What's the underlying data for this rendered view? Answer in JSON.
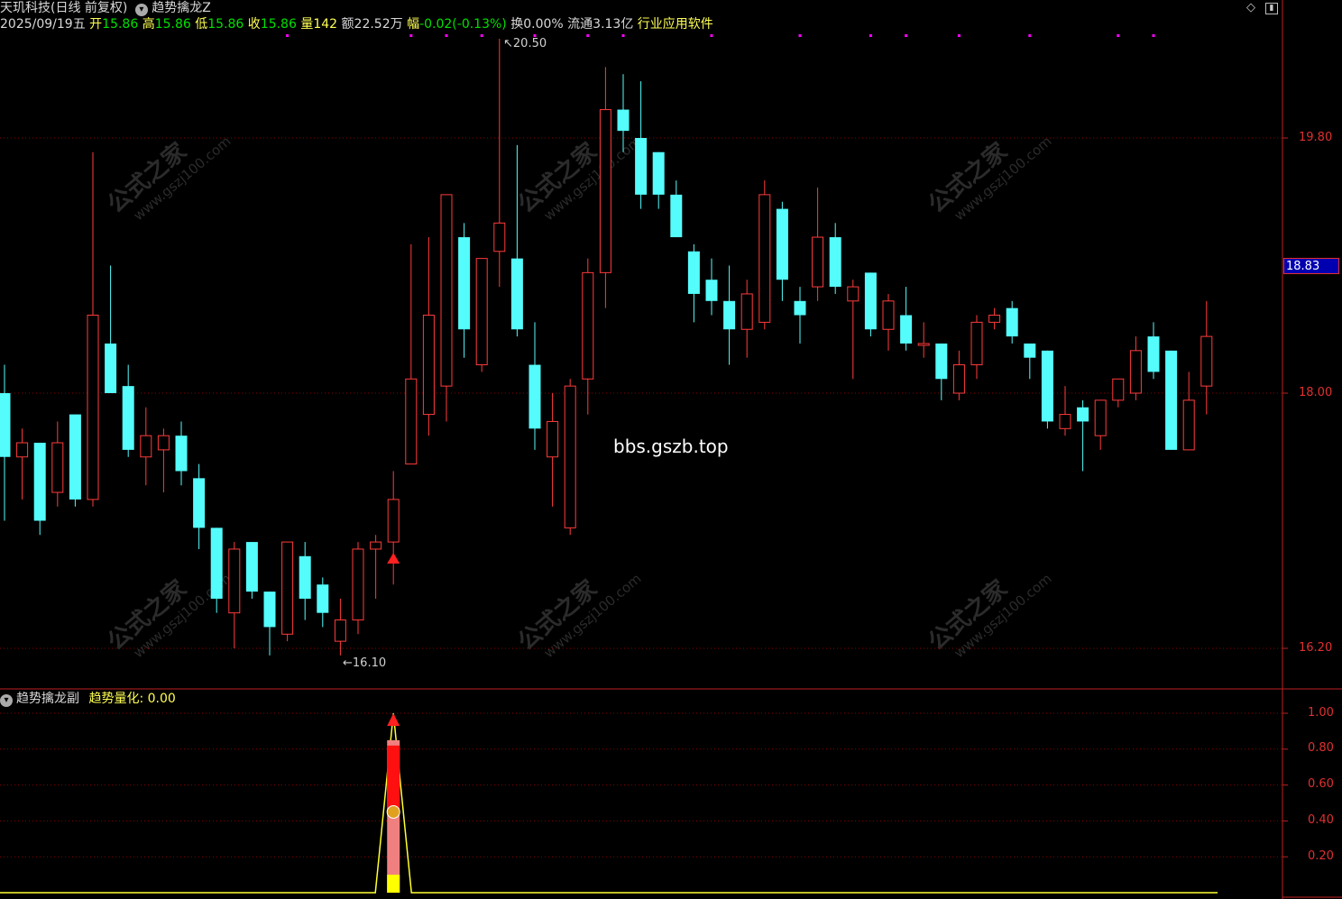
{
  "header": {
    "stock_name": "天玑科技",
    "period": "(日线 前复权)",
    "indicator": "趋势擒龙Z",
    "date": "2025/09/19",
    "weekday": "五",
    "open_label": "开",
    "open": "15.86",
    "high_label": "高",
    "high": "15.86",
    "low_label": "低",
    "low": "15.86",
    "close_label": "收",
    "close": "15.86",
    "vol_label": "量",
    "vol": "142",
    "amount_label": "额",
    "amount": "22.52万",
    "change_label": "幅",
    "change": "-0.02(-0.13%)",
    "turnover_label": "换",
    "turnover": "0.00%",
    "float_label": "流通",
    "float": "3.13亿",
    "industry": "行业应用软件"
  },
  "main_chart": {
    "y_labels": [
      "19.80",
      "18.83",
      "18.00",
      "16.20"
    ],
    "current_price": "18.83",
    "high_marker": "20.50",
    "low_marker": "16.10",
    "site_text": "bbs.gszb.top",
    "colors": {
      "up": "#ff3b3b",
      "down": "#54fcfc",
      "grid": "#8b0000",
      "marker": "#ff00ff"
    }
  },
  "sub_chart": {
    "title": "趋势擒龙副",
    "series_label": "趋势量化:",
    "series_value": "0.00",
    "y_labels": [
      "1.00",
      "0.80",
      "0.60",
      "0.40",
      "0.20"
    ]
  },
  "watermark": {
    "cn": "公式之家",
    "url": "www.gszj100.com"
  },
  "chart_data": {
    "type": "candlestick",
    "price_axis": {
      "labels": [
        19.8,
        18.0,
        16.2
      ]
    },
    "candles": [
      {
        "o": 18.0,
        "h": 18.2,
        "l": 17.1,
        "c": 17.55
      },
      {
        "o": 17.55,
        "h": 17.75,
        "l": 17.25,
        "c": 17.65
      },
      {
        "o": 17.65,
        "h": 17.65,
        "l": 17.0,
        "c": 17.1
      },
      {
        "o": 17.3,
        "h": 17.8,
        "l": 17.2,
        "c": 17.65
      },
      {
        "o": 17.85,
        "h": 17.85,
        "l": 17.2,
        "c": 17.25
      },
      {
        "o": 17.25,
        "h": 19.7,
        "l": 17.2,
        "c": 18.55
      },
      {
        "o": 18.35,
        "h": 18.9,
        "l": 18.0,
        "c": 18.0
      },
      {
        "o": 18.05,
        "h": 18.2,
        "l": 17.55,
        "c": 17.6
      },
      {
        "o": 17.55,
        "h": 17.9,
        "l": 17.35,
        "c": 17.7
      },
      {
        "o": 17.6,
        "h": 17.75,
        "l": 17.3,
        "c": 17.7
      },
      {
        "o": 17.7,
        "h": 17.8,
        "l": 17.35,
        "c": 17.45
      },
      {
        "o": 17.4,
        "h": 17.5,
        "l": 16.9,
        "c": 17.05
      },
      {
        "o": 17.05,
        "h": 17.05,
        "l": 16.45,
        "c": 16.55
      },
      {
        "o": 16.45,
        "h": 16.95,
        "l": 16.2,
        "c": 16.9
      },
      {
        "o": 16.95,
        "h": 16.95,
        "l": 16.55,
        "c": 16.6
      },
      {
        "o": 16.6,
        "h": 16.6,
        "l": 16.15,
        "c": 16.35
      },
      {
        "o": 16.3,
        "h": 16.95,
        "l": 16.25,
        "c": 16.95
      },
      {
        "o": 16.85,
        "h": 16.95,
        "l": 16.4,
        "c": 16.55
      },
      {
        "o": 16.65,
        "h": 16.7,
        "l": 16.35,
        "c": 16.45
      },
      {
        "o": 16.25,
        "h": 16.55,
        "l": 16.15,
        "c": 16.4
      },
      {
        "o": 16.4,
        "h": 16.95,
        "l": 16.3,
        "c": 16.9
      },
      {
        "o": 16.9,
        "h": 17.0,
        "l": 16.55,
        "c": 16.95
      },
      {
        "o": 16.95,
        "h": 17.45,
        "l": 16.65,
        "c": 17.25
      },
      {
        "o": 17.5,
        "h": 19.05,
        "l": 17.5,
        "c": 18.1
      },
      {
        "o": 17.85,
        "h": 19.1,
        "l": 17.7,
        "c": 18.55
      },
      {
        "o": 18.05,
        "h": 19.3,
        "l": 17.8,
        "c": 19.4
      },
      {
        "o": 19.1,
        "h": 19.2,
        "l": 18.25,
        "c": 18.45
      },
      {
        "o": 18.2,
        "h": 18.95,
        "l": 18.15,
        "c": 18.95
      },
      {
        "o": 19.0,
        "h": 20.5,
        "l": 18.75,
        "c": 19.2
      },
      {
        "o": 18.95,
        "h": 19.75,
        "l": 18.4,
        "c": 18.45
      },
      {
        "o": 18.2,
        "h": 18.5,
        "l": 17.6,
        "c": 17.75
      },
      {
        "o": 17.55,
        "h": 18.0,
        "l": 17.2,
        "c": 17.8
      },
      {
        "o": 17.05,
        "h": 18.1,
        "l": 17.0,
        "c": 18.05
      },
      {
        "o": 18.1,
        "h": 18.95,
        "l": 17.85,
        "c": 18.85
      },
      {
        "o": 18.85,
        "h": 20.3,
        "l": 18.6,
        "c": 20.0
      },
      {
        "o": 20.0,
        "h": 20.25,
        "l": 19.7,
        "c": 19.85
      },
      {
        "o": 19.8,
        "h": 20.2,
        "l": 19.3,
        "c": 19.4
      },
      {
        "o": 19.7,
        "h": 19.7,
        "l": 19.3,
        "c": 19.4
      },
      {
        "o": 19.4,
        "h": 19.5,
        "l": 19.1,
        "c": 19.1
      },
      {
        "o": 19.0,
        "h": 19.05,
        "l": 18.5,
        "c": 18.7
      },
      {
        "o": 18.8,
        "h": 18.95,
        "l": 18.55,
        "c": 18.65
      },
      {
        "o": 18.65,
        "h": 18.9,
        "l": 18.2,
        "c": 18.45
      },
      {
        "o": 18.45,
        "h": 18.8,
        "l": 18.25,
        "c": 18.7
      },
      {
        "o": 18.5,
        "h": 19.5,
        "l": 18.45,
        "c": 19.4
      },
      {
        "o": 19.3,
        "h": 19.35,
        "l": 18.65,
        "c": 18.8
      },
      {
        "o": 18.65,
        "h": 18.75,
        "l": 18.35,
        "c": 18.55
      },
      {
        "o": 18.75,
        "h": 19.45,
        "l": 18.65,
        "c": 19.1
      },
      {
        "o": 19.1,
        "h": 19.2,
        "l": 18.7,
        "c": 18.75
      },
      {
        "o": 18.65,
        "h": 18.8,
        "l": 18.1,
        "c": 18.75
      },
      {
        "o": 18.85,
        "h": 18.85,
        "l": 18.4,
        "c": 18.45
      },
      {
        "o": 18.45,
        "h": 18.7,
        "l": 18.3,
        "c": 18.65
      },
      {
        "o": 18.55,
        "h": 18.75,
        "l": 18.3,
        "c": 18.35
      },
      {
        "o": 18.35,
        "h": 18.5,
        "l": 18.25,
        "c": 18.35
      },
      {
        "o": 18.35,
        "h": 18.35,
        "l": 17.95,
        "c": 18.1
      },
      {
        "o": 18.0,
        "h": 18.3,
        "l": 17.95,
        "c": 18.2
      },
      {
        "o": 18.2,
        "h": 18.55,
        "l": 18.1,
        "c": 18.5
      },
      {
        "o": 18.5,
        "h": 18.6,
        "l": 18.45,
        "c": 18.55
      },
      {
        "o": 18.6,
        "h": 18.65,
        "l": 18.35,
        "c": 18.4
      },
      {
        "o": 18.35,
        "h": 18.35,
        "l": 18.1,
        "c": 18.25
      },
      {
        "o": 18.3,
        "h": 18.3,
        "l": 17.75,
        "c": 17.8
      },
      {
        "o": 17.75,
        "h": 18.05,
        "l": 17.7,
        "c": 17.85
      },
      {
        "o": 17.9,
        "h": 17.95,
        "l": 17.45,
        "c": 17.8
      },
      {
        "o": 17.7,
        "h": 17.95,
        "l": 17.6,
        "c": 17.95
      },
      {
        "o": 17.95,
        "h": 18.05,
        "l": 17.9,
        "c": 18.1
      },
      {
        "o": 18.0,
        "h": 18.4,
        "l": 17.95,
        "c": 18.3
      },
      {
        "o": 18.4,
        "h": 18.5,
        "l": 18.1,
        "c": 18.15
      },
      {
        "o": 18.3,
        "h": 18.3,
        "l": 17.6,
        "c": 17.6
      },
      {
        "o": 17.6,
        "h": 18.15,
        "l": 17.6,
        "c": 17.95
      },
      {
        "o": 18.05,
        "h": 18.65,
        "l": 17.85,
        "c": 18.4
      }
    ],
    "buy_signal_index": 22,
    "markers_top": [
      16,
      23,
      25,
      27,
      30,
      33,
      35,
      40,
      45,
      49,
      51,
      54,
      58,
      63,
      65
    ],
    "sub_indicator": {
      "name": "趋势量化",
      "signal_index": 22,
      "peak": 1.0,
      "y_range": [
        0,
        1.0
      ]
    }
  }
}
